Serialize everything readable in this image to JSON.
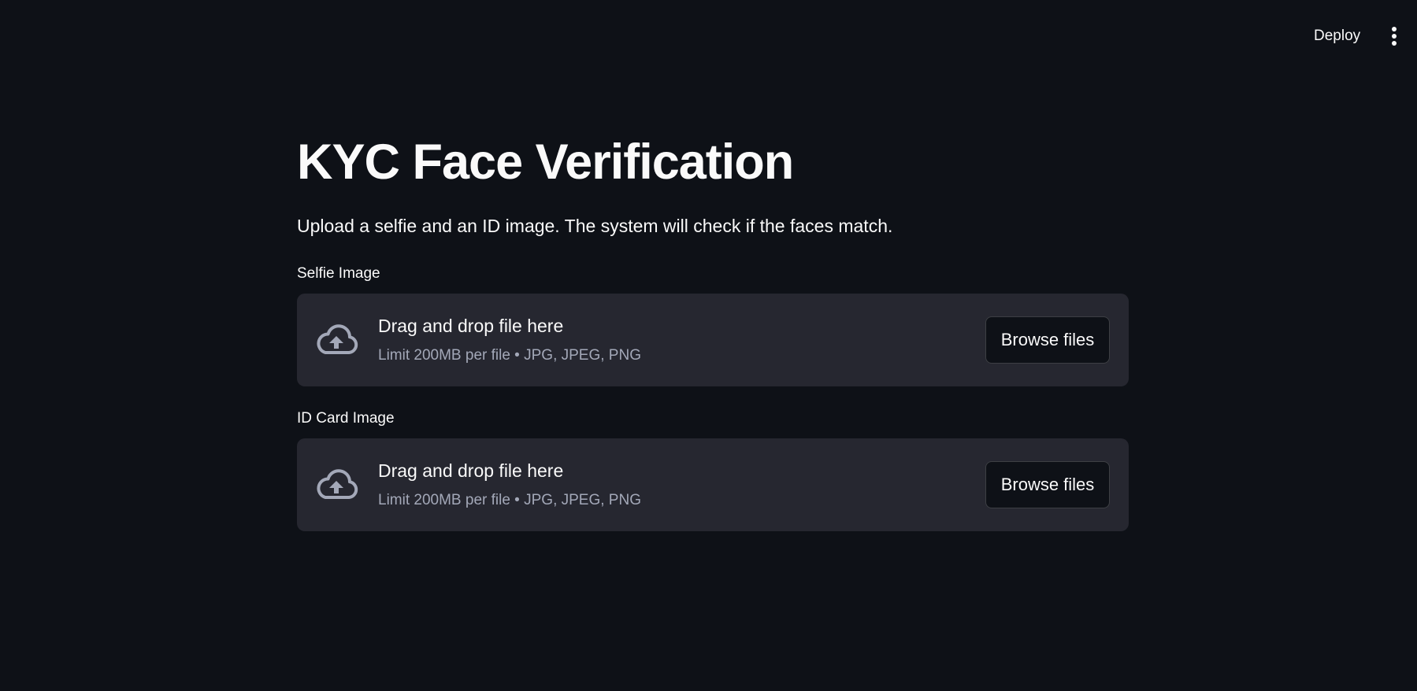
{
  "header": {
    "deploy_label": "Deploy",
    "menu_icon": "kebab-menu-icon"
  },
  "main": {
    "title": "KYC Face Verification",
    "description": "Upload a selfie and an ID image. The system will check if the faces match.",
    "uploaders": [
      {
        "label": "Selfie Image",
        "instructions": "Drag and drop file here",
        "limit": "Limit 200MB per file • JPG, JPEG, PNG",
        "button_label": "Browse files",
        "icon": "cloud-upload-icon"
      },
      {
        "label": "ID Card Image",
        "instructions": "Drag and drop file here",
        "limit": "Limit 200MB per file • JPG, JPEG, PNG",
        "button_label": "Browse files",
        "icon": "cloud-upload-icon"
      }
    ]
  },
  "colors": {
    "background": "#0e1117",
    "dropzone": "#262730",
    "text": "#fafafa",
    "muted_text": "#a3a8b8",
    "icon": "#a3a8b8"
  }
}
